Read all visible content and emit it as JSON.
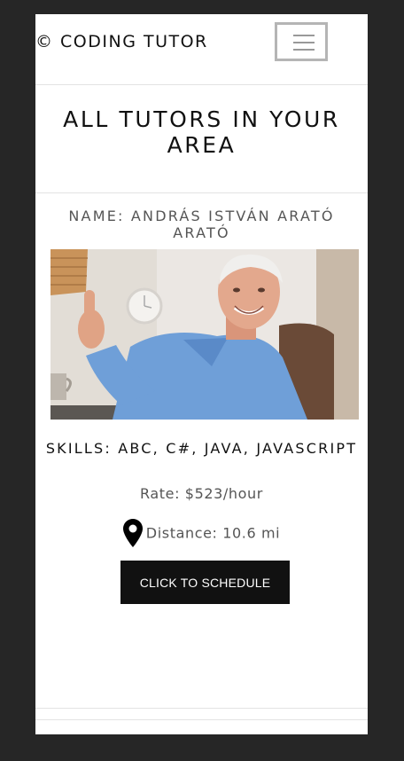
{
  "header": {
    "brand": "© CODING TUTOR",
    "menu_icon": "hamburger-menu-icon"
  },
  "main": {
    "title": "ALL TUTORS IN YOUR AREA"
  },
  "tutor": {
    "name_label": "NAME: ANDRÁS ISTVÁN ARATÓ ARATÓ",
    "skills_label": "SKILLS: ABC, C#, JAVA, JAVASCRIPT",
    "rate_label": "Rate: $523/hour",
    "distance_label": "Distance: 10.6 mi",
    "distance_icon": "map-pin-icon",
    "schedule_button": "CLICK TO SCHEDULE"
  },
  "colors": {
    "page_background": "#262626",
    "button_background": "#111111",
    "button_text": "#ffffff"
  }
}
